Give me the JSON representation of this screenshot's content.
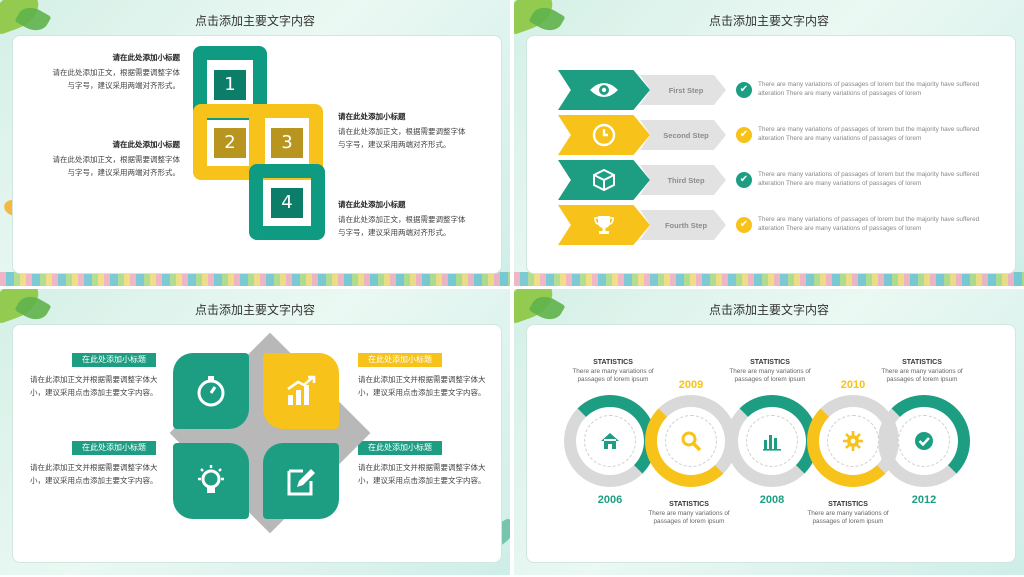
{
  "slides": [
    {
      "title": "点击添加主要文字内容",
      "items": [
        {
          "heading": "请在此处添加小标题",
          "body": "请在此处添加正文，根据需要调整字体与字号，建议采用两端对齐形式。"
        },
        {
          "heading": "请在此处添加小标题",
          "body": "请在此处添加正文，根据需要调整字体与字号，建议采用两端对齐形式。"
        },
        {
          "heading": "请在此处添加小标题",
          "body": "请在此处添加正文，根据需要调整字体与字号，建议采用两端对齐形式。"
        },
        {
          "heading": "请在此处添加小标题",
          "body": "请在此处添加正文，根据需要调整字体与字号，建议采用两端对齐形式。"
        }
      ],
      "numbers": [
        "1",
        "2",
        "3",
        "4"
      ]
    },
    {
      "title": "点击添加主要文字内容",
      "steps": [
        {
          "label": "First Step",
          "icon": "eye-icon",
          "color": "#1d9e82",
          "desc": "There are many variations of passages of lorem but the majority have suffered alteration There are many  variations of passages of lorem"
        },
        {
          "label": "Second Step",
          "icon": "clock-icon",
          "color": "#f7c21a",
          "desc": "There are many variations of passages of lorem but the majority have suffered alteration There are many  variations of passages of lorem"
        },
        {
          "label": "Third Step",
          "icon": "cube-icon",
          "color": "#1d9e82",
          "desc": "There are many variations of passages of lorem but the majority have suffered alteration There are many  variations of passages of lorem"
        },
        {
          "label": "Fourth Step",
          "icon": "trophy-icon",
          "color": "#f7c21a",
          "desc": "There are many variations of passages of lorem but the majority have suffered alteration There are many  variations of passages of lorem"
        }
      ]
    },
    {
      "title": "点击添加主要文字内容",
      "items": [
        {
          "tag": "在此处添加小标题",
          "body": "请在此添加正文并根据需要调整字体大小，建议采用点击添加主要文字内容。"
        },
        {
          "tag": "在此处添加小标题",
          "body": "请在此添加正文并根据需要调整字体大小，建议采用点击添加主要文字内容。"
        },
        {
          "tag": "在此处添加小标题",
          "body": "请在此添加正文并根据需要调整字体大小，建议采用点击添加主要文字内容。"
        },
        {
          "tag": "在此处添加小标题",
          "body": "请在此添加正文并根据需要调整字体大小，建议采用点击添加主要文字内容。"
        }
      ],
      "icons": [
        "stopwatch-icon",
        "chart-up-icon",
        "lightbulb-icon",
        "edit-icon"
      ]
    },
    {
      "title": "点击添加主要文字内容",
      "milestones": [
        {
          "year": "2006",
          "icon": "home-icon",
          "stat_title": "STATISTICS",
          "stat_text": "There are many variations of passages of lorem ipsum"
        },
        {
          "year": "2009",
          "icon": "search-icon",
          "stat_title": "STATISTICS",
          "stat_text": "There are many variations of passages of lorem ipsum"
        },
        {
          "year": "2008",
          "icon": "bar-chart-icon",
          "stat_title": "STATISTICS",
          "stat_text": "There are many variations of passages of lorem ipsum"
        },
        {
          "year": "2010",
          "icon": "gear-icon",
          "stat_title": "STATISTICS",
          "stat_text": "There are many variations of passages of lorem ipsum"
        },
        {
          "year": "2012",
          "icon": "check-circle-icon",
          "stat_title": "STATISTICS",
          "stat_text": "There are many variations of passages of lorem ipsum"
        }
      ],
      "colors": {
        "green": "#1d9e82",
        "yellow": "#f7c21a",
        "gray": "#d9d9d9"
      }
    }
  ]
}
